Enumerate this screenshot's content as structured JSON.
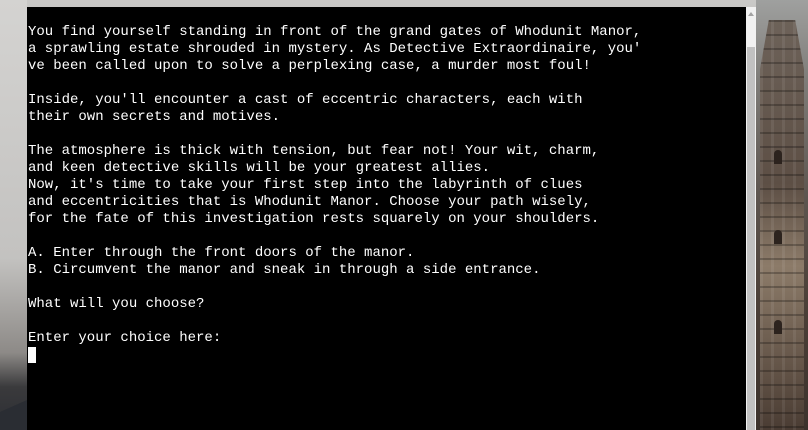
{
  "terminal": {
    "lines": [
      "You find yourself standing in front of the grand gates of Whodunit Manor,",
      "a sprawling estate shrouded in mystery. As Detective Extraordinaire, you'",
      "ve been called upon to solve a perplexing case, a murder most foul!",
      "",
      "Inside, you'll encounter a cast of eccentric characters, each with",
      "their own secrets and motives.",
      "",
      "The atmosphere is thick with tension, but fear not! Your wit, charm,",
      "and keen detective skills will be your greatest allies.",
      "Now, it's time to take your first step into the labyrinth of clues",
      "and eccentricities that is Whodunit Manor. Choose your path wisely,",
      "for the fate of this investigation rests squarely on your shoulders.",
      "",
      "A. Enter through the front doors of the manor.",
      "B. Circumvent the manor and sneak in through a side entrance.",
      "",
      "What will you choose?",
      "",
      "Enter your choice here:"
    ],
    "input_value": ""
  },
  "colors": {
    "terminal_bg": "#000000",
    "terminal_text": "#ffffff",
    "scrollbar_track": "#f1f1f1",
    "scrollbar_thumb": "#c1c1c1"
  }
}
